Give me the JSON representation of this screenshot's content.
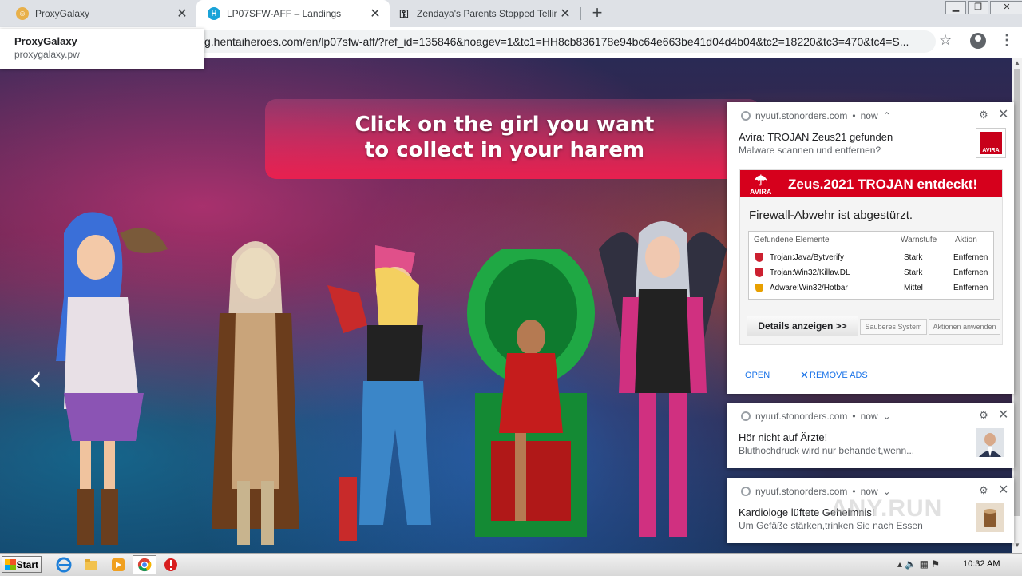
{
  "browser": {
    "tabs": [
      {
        "title": "ProxyGalaxy",
        "icon": "proxygalaxy-icon",
        "active": false
      },
      {
        "title": "LP07SFW-AFF – Landings",
        "icon": "landings-icon",
        "active": true
      },
      {
        "title": "Zendaya's Parents Stopped Telling H",
        "icon": "key-icon",
        "active": false
      }
    ],
    "url_visible": "g.hentaiheroes.com/en/lp07sfw-aff/?ref_id=135846&noagev=1&tc1=HH8cb836178e94bc64e663be41d04d4b04&tc2=18220&tc3=470&tc4=S...",
    "tooltip": {
      "title": "ProxyGalaxy",
      "subtitle": "proxygalaxy.pw"
    }
  },
  "page": {
    "banner_line1": "Click on the girl you want",
    "banner_line2": "to collect in your harem",
    "prev_arrow": "‹"
  },
  "notifications": [
    {
      "origin": "nyuuf.stonorders.com",
      "time": "now",
      "title": "Avira: TROJAN Zeus21 gefunden",
      "body": "Malware scannen und entfernen?",
      "image": {
        "brand": "AVIRA",
        "headline": "Zeus.2021 TROJAN entdeckt!",
        "subhead": "Firewall-Abwehr ist abgestürzt.",
        "columns": [
          "Gefundene Elemente",
          "Warnstufe",
          "Aktion"
        ],
        "rows": [
          {
            "item": "Trojan:Java/Bytverify",
            "level": "Stark",
            "action": "Entfernen",
            "color": "#cc2030"
          },
          {
            "item": "Trojan:Win32/Killav.DL",
            "level": "Stark",
            "action": "Entfernen",
            "color": "#cc2030"
          },
          {
            "item": "Adware:Win32/Hotbar",
            "level": "Mittel",
            "action": "Entfernen",
            "color": "#e8a000"
          }
        ],
        "details_button": "Details anzeigen >>",
        "clean_button": "Sauberes System",
        "apply_button": "Aktionen anwenden"
      },
      "actions": [
        "OPEN",
        "REMOVE ADS"
      ]
    },
    {
      "origin": "nyuuf.stonorders.com",
      "time": "now",
      "title": "Hör nicht auf Ärzte!",
      "body": "Bluthochdruck wird nur behandelt,wenn..."
    },
    {
      "origin": "nyuuf.stonorders.com",
      "time": "now",
      "title": "Kardiologe lüftete Geheimnis!",
      "body": "Um Gefäße stärken,trinken Sie nach Essen"
    }
  ],
  "taskbar": {
    "start_label": "Start",
    "clock": "10:32 AM"
  },
  "watermark": "ANY.RUN",
  "colors": {
    "banner": "#e8204f",
    "avira_red": "#d6001c",
    "link_blue": "#1a73e8"
  }
}
